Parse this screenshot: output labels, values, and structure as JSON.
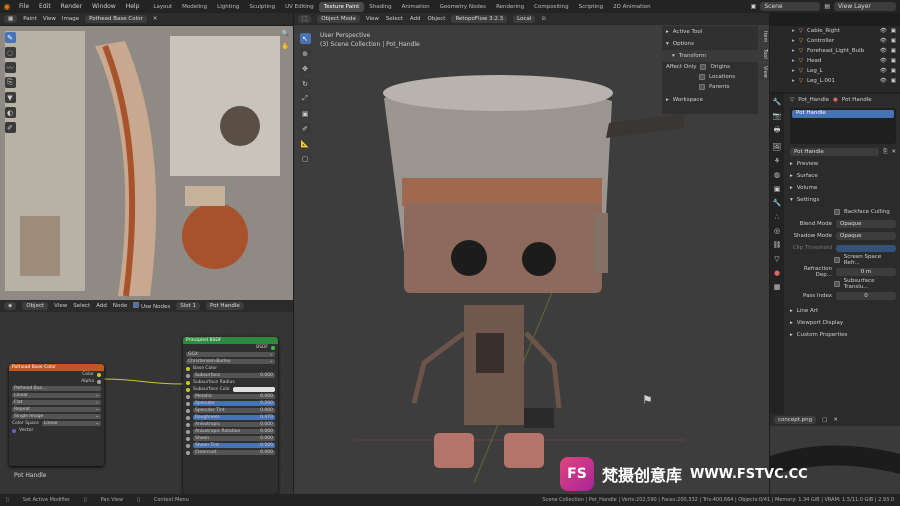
{
  "topbar": {
    "menus": [
      "File",
      "Edit",
      "Render",
      "Window",
      "Help"
    ],
    "workspaces": [
      "Layout",
      "Modeling",
      "Lighting",
      "Sculpting",
      "UV Editing",
      "Texture Paint",
      "Shading",
      "Animation",
      "Geometry Nodes",
      "Rendering",
      "Compositing",
      "Scripting",
      "2D Animation"
    ],
    "active_workspace": "Texture Paint",
    "scene": "Scene",
    "view_layer": "View Layer"
  },
  "image_editor": {
    "mode": "Paint",
    "view": "View",
    "image": "Image",
    "image_name": "Pothead Base Color"
  },
  "viewport": {
    "mode": "Object Mode",
    "menus": [
      "View",
      "Select",
      "Add",
      "Object"
    ],
    "addon": "RetopoFlow 3.2.3",
    "orientation": "Local",
    "overlay_title": "User Perspective",
    "overlay_sub": "(3) Scene Collection | Pot_Handle"
  },
  "n_panel": {
    "active_tool": "Active Tool",
    "options": "Options",
    "transform": "Transform",
    "affect_only": "Affect Only",
    "origins": "Origins",
    "locations": "Locations",
    "parents": "Parents",
    "workspace": "Workspace",
    "tabs": [
      "Item",
      "Tool",
      "View"
    ]
  },
  "outliner": {
    "items": [
      "Cable_Right",
      "Controller",
      "Forehead_Light_Bulb",
      "Head",
      "Leg_L",
      "Leg_L.001"
    ]
  },
  "properties": {
    "object": "Pot_Handle",
    "material_tab": "Pot Handle",
    "slot": "Pot Handle",
    "material_name": "Pot Handle",
    "sections": [
      "Preview",
      "Surface",
      "Volume",
      "Settings"
    ],
    "backface": "Backface Culling",
    "blend_label": "Blend Mode",
    "blend_value": "Opaque",
    "shadow_label": "Shadow Mode",
    "shadow_value": "Opaque",
    "clip_label": "Clip Threshold",
    "ssr": "Screen Space Refr...",
    "refr_label": "Refraction Dep...",
    "refr_value": "0 m",
    "sst": "Subsurface Translu...",
    "pass_label": "Pass Index",
    "pass_value": "0",
    "more_sections": [
      "Line Art",
      "Viewport Display",
      "Custom Properties"
    ]
  },
  "bottom_right": {
    "image_name": "concept.png"
  },
  "node_editor": {
    "header": {
      "editor": "Object",
      "menus": [
        "View",
        "Select",
        "Add",
        "Node"
      ],
      "use_nodes": "Use Nodes",
      "slot": "Slot 1",
      "material": "Pot Handle"
    },
    "tex_node": {
      "title": "Pothead Base Color",
      "out1": "Color",
      "out2": "Alpha",
      "img": "Pothead Bas...",
      "interp": "Linear",
      "proj": "Flat",
      "ext": "Repeat",
      "src": "Single Image",
      "cs_label": "Color Space",
      "cs_value": "Linear",
      "vector": "Vector"
    },
    "bsdf": {
      "title": "Principled BSDF",
      "out": "BSDF",
      "dist": "GGX",
      "ssm": "Christensen-Burley",
      "rows": [
        {
          "label": "Base Color",
          "value": "",
          "kind": "socket"
        },
        {
          "label": "Subsurface",
          "value": "0.000",
          "kind": "field"
        },
        {
          "label": "Subsurface Radius",
          "value": "",
          "kind": "socket"
        },
        {
          "label": "Subsurface Colo",
          "value": "",
          "kind": "white"
        },
        {
          "label": "Metallic",
          "value": "0.000",
          "kind": "field"
        },
        {
          "label": "Specular",
          "value": "0.200",
          "kind": "blue"
        },
        {
          "label": "Specular Tint",
          "value": "0.000",
          "kind": "field"
        },
        {
          "label": "Roughness",
          "value": "0.470",
          "kind": "blue"
        },
        {
          "label": "Anisotropic",
          "value": "0.000",
          "kind": "field"
        },
        {
          "label": "Anisotropic Rotation",
          "value": "0.000",
          "kind": "field"
        },
        {
          "label": "Sheen",
          "value": "0.000",
          "kind": "field"
        },
        {
          "label": "Sheen Tint",
          "value": "0.500",
          "kind": "blue"
        },
        {
          "label": "Clearcoat",
          "value": "0.000",
          "kind": "field"
        }
      ]
    },
    "footer_label": "Pot Handle"
  },
  "statusbar": {
    "left": "Set Active Modifier",
    "mid": "Pan View",
    "ctx": "Context Menu",
    "stats": "Scene Collection | Pot_Handle | Verts:202,590 | Faces:200,332 | Tris:400,664 | Objects:0/41 | Memory: 1.34 GiB | VRAM: 1.5/11.0 GiB | 2.93.0"
  },
  "watermark": {
    "logo": "FS",
    "text": "梵摄创意库",
    "url": "WWW.FSTVC.CC"
  },
  "colors": {
    "accent": "#4772b3",
    "node_tex_header": "#c2581d",
    "node_bsdf_header": "#2e8a3e"
  }
}
